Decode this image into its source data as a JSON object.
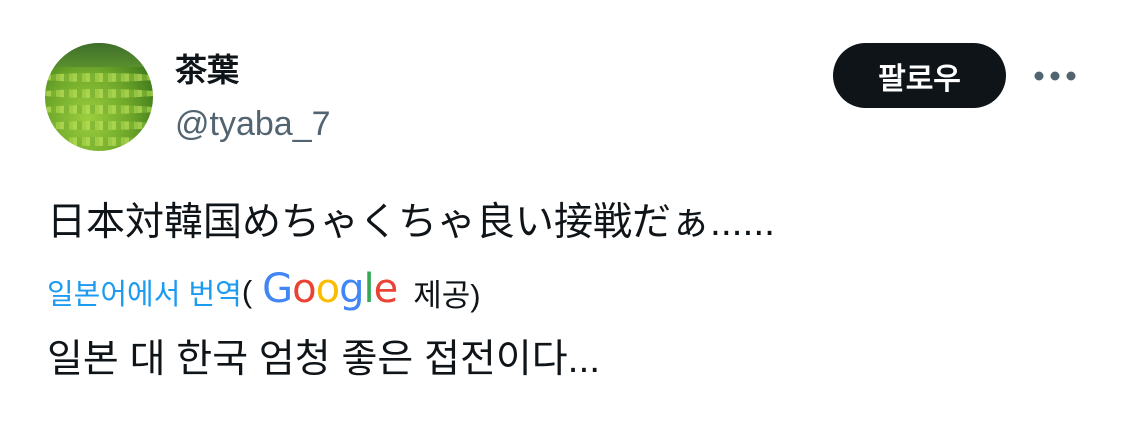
{
  "user": {
    "display_name": "茶葉",
    "handle": "@tyaba_7"
  },
  "actions": {
    "follow_label": "팔로우",
    "more_icon": "more-horizontal-icon"
  },
  "tweet": {
    "text": "日本対韓国めちゃくちゃ良い接戦だぁ......",
    "translate_link": "일본어에서 번역",
    "paren_open": "(",
    "provider_logo": "Google",
    "provided_suffix": "제공)",
    "translated_text": "일본 대 한국 엄청 좋은 접전이다..."
  },
  "colors": {
    "text": "#0f1419",
    "secondary": "#536471",
    "link": "#1d9bf0",
    "button_bg": "#0f1419"
  }
}
